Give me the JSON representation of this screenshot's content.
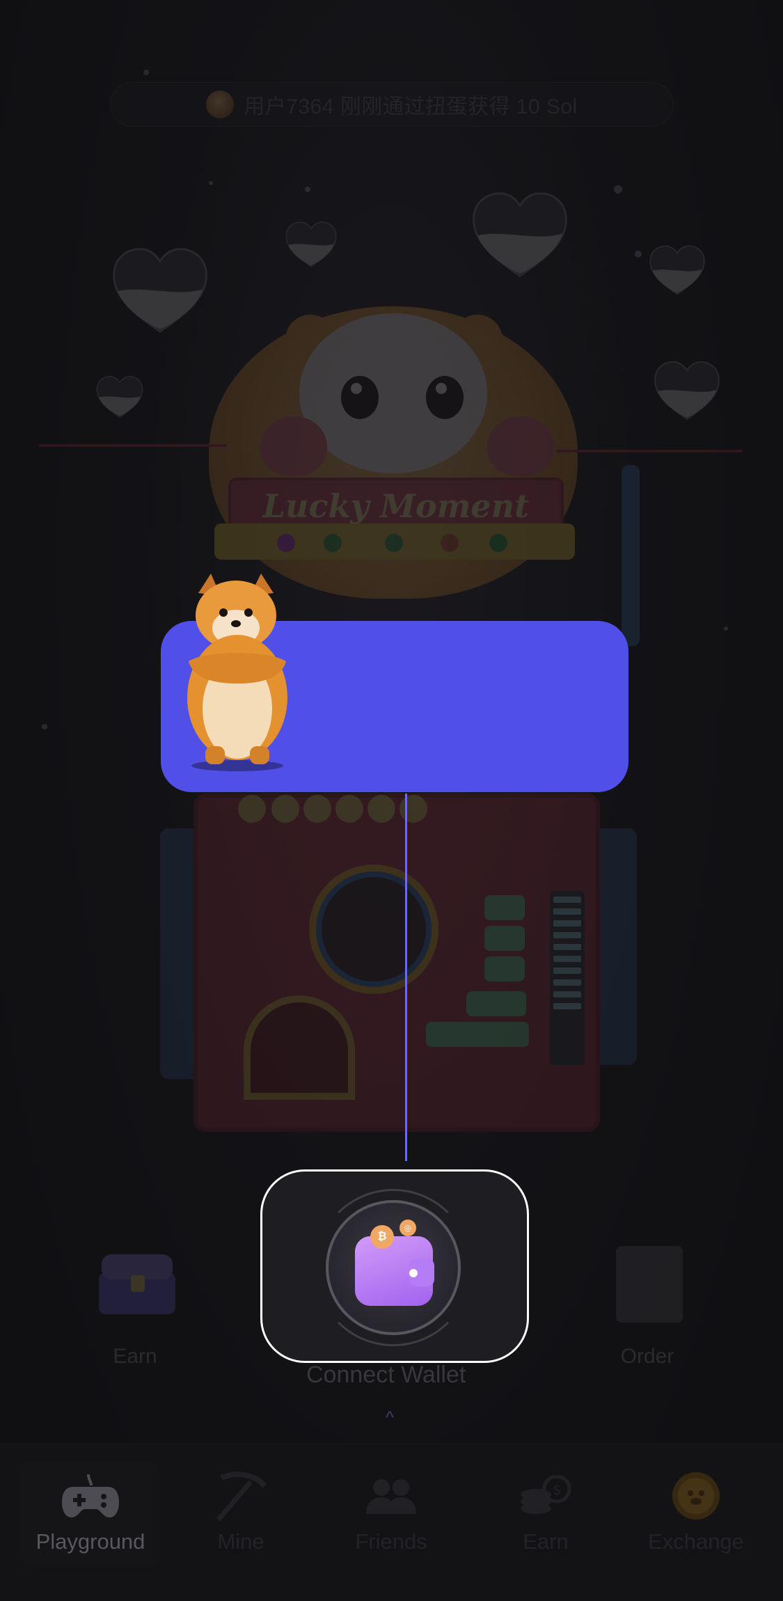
{
  "ticker": {
    "text": "用户7364 刚刚通过扭蛋获得 10 Sol"
  },
  "machine": {
    "sign_text": "Lucky Moment"
  },
  "shortcuts": {
    "earn_label": "Earn",
    "connect_wallet_label": "Connect Wallet",
    "order_label": "Order"
  },
  "tutorial": {
    "tip_text": ""
  },
  "tabs": [
    {
      "label": "Playground",
      "icon": "gamepad-icon",
      "active": true
    },
    {
      "label": "Mine",
      "icon": "pickaxe-icon",
      "active": false
    },
    {
      "label": "Friends",
      "icon": "friends-icon",
      "active": false
    },
    {
      "label": "Earn",
      "icon": "coins-icon",
      "active": false
    },
    {
      "label": "Exchange",
      "icon": "hamster-coin-icon",
      "active": false
    }
  ],
  "colors": {
    "tip_card": "#5050e8",
    "pointer": "#6b6bf0",
    "wallet": "#b57df5",
    "background": "#131316"
  }
}
